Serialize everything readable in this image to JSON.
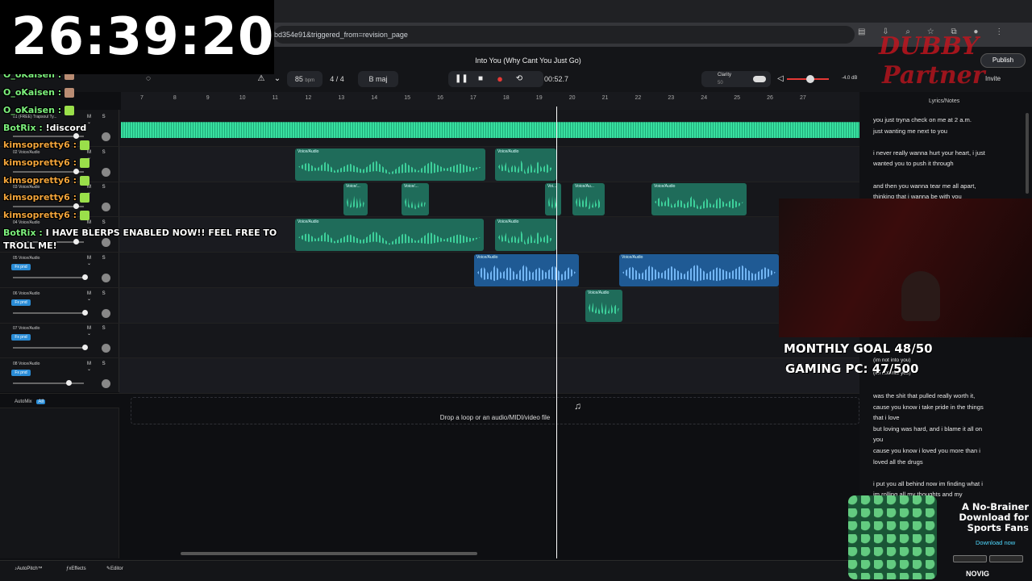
{
  "browser": {
    "url": "bd354e91&triggered_from=revision_page",
    "icons": [
      "columns-icon",
      "download-icon",
      "zoom-icon",
      "star-icon",
      "extensions-icon",
      "profile-icon",
      "menu-icon"
    ]
  },
  "timer": {
    "text": "26:39:20"
  },
  "transport": {
    "song_title": "Into You (Why Cant You Just Go)",
    "bpm": "85",
    "bpm_unit": "bpm",
    "time_sig": "4 / 4",
    "key": "B maj",
    "position": "00:52.7",
    "clarity_label": "Clarity",
    "clarity_value": "50",
    "volume_db": "-4.0 dB",
    "publish": "Publish",
    "invite": "Invite"
  },
  "ruler": {
    "bars": [
      "7",
      "8",
      "9",
      "10",
      "11",
      "12",
      "13",
      "14",
      "15",
      "16",
      "17",
      "18",
      "19",
      "20",
      "21",
      "22",
      "23",
      "24",
      "25",
      "26",
      "27"
    ]
  },
  "tracks": [
    {
      "num": "01",
      "name": "(FREE) Trapsoul Ty...",
      "fx": ""
    },
    {
      "num": "02",
      "name": "Voice/Audio",
      "fx": ""
    },
    {
      "num": "03",
      "name": "Voice/Audio",
      "fx": ""
    },
    {
      "num": "04",
      "name": "Voice/Audio",
      "fx": ""
    },
    {
      "num": "05",
      "name": "Voice/Audio",
      "fx": "Fx pnd"
    },
    {
      "num": "06",
      "name": "Voice/Audio",
      "fx": "Fx pnd"
    },
    {
      "num": "07",
      "name": "Voice/Audio",
      "fx": "Fx pnd"
    },
    {
      "num": "08",
      "name": "Voice/Audio",
      "fx": "Fx pnd"
    }
  ],
  "clip_labels": {
    "voice": "Voice/Audio",
    "voice_short": "Voice/...",
    "voice_au": "Voice/Au...",
    "voice_v": "Voi..."
  },
  "add_track": "+ Add Track",
  "automix": {
    "label": "AutoMix",
    "badge": "All"
  },
  "drop_zone": "Drop a loop or an audio/MIDI/video file",
  "bottom": {
    "autopitch": "AutoPitch™",
    "effects": "Effects",
    "editor": "Editor"
  },
  "lyrics": {
    "title": "Lyrics/Notes",
    "lines": [
      "you just tryna check on me at 2 a.m.",
      "just wanting me next to you",
      "",
      "i never really wanna hurt your heart, i just",
      "wanted you to push it through",
      "",
      "and then you wanna tear me all apart,",
      "thinking that i wanna be with you"
    ],
    "lower_lines": [
      "was the shit that pulled really worth it,",
      "cause you know i take pride in the things",
      "that i love",
      "but loving was hard, and i blame it all on",
      "you",
      "cause you know i loved you more than i",
      "loved all the drugs",
      "",
      "i put you all behind now im finding what i",
      "im rolling all my thoughts and my"
    ],
    "partial": [
      "(im not into you)",
      "(im not into you)"
    ]
  },
  "chat": [
    {
      "user": "O_oKaisen :",
      "msg": "",
      "color": "green",
      "emote": "face"
    },
    {
      "user": "O_oKaisen :",
      "msg": "",
      "color": "green",
      "emote": "face"
    },
    {
      "user": "O_oKaisen :",
      "msg": "",
      "color": "green",
      "emote": "frog"
    },
    {
      "user": "BotRix :",
      "msg": "!discord",
      "color": "green",
      "emote": ""
    },
    {
      "user": "kimsopretty6 :",
      "msg": "",
      "color": "orange",
      "emote": "frog"
    },
    {
      "user": "kimsopretty6 :",
      "msg": "",
      "color": "orange",
      "emote": "frog"
    },
    {
      "user": "kimsopretty6 :",
      "msg": "",
      "color": "orange",
      "emote": "frog"
    },
    {
      "user": "kimsopretty6 :",
      "msg": "",
      "color": "orange",
      "emote": "frog"
    },
    {
      "user": "kimsopretty6 :",
      "msg": "",
      "color": "orange",
      "emote": "frog"
    },
    {
      "user": "BotRix :",
      "msg": "I HAVE BLERPS ENABLED NOW!! FEEL FREE TO",
      "color": "green",
      "emote": ""
    }
  ],
  "chat_wrap": "TROLL ME!",
  "goals": {
    "monthly": "MONTHLY GOAL 48/50",
    "gaming": "GAMING PC: 47/500"
  },
  "dubby": {
    "brand": "DUBBY",
    "sub": "Partner"
  },
  "ad": {
    "headline": "A No-Brainer Download for Sports Fans",
    "cta": "Download now",
    "logo": "NOVIG"
  },
  "colors": {
    "clip_green": "#1f6c5a",
    "clip_blue": "#1f5a94",
    "record": "#e53935",
    "accent": "#38e0a0"
  }
}
